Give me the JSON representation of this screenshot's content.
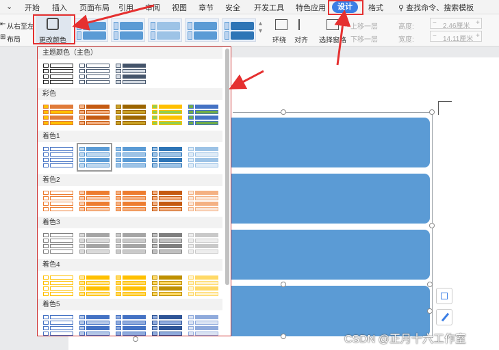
{
  "menubar": {
    "dropdown_icon": "chevron-down-icon",
    "items": [
      "开始",
      "插入",
      "页面布局",
      "引用",
      "审阅",
      "视图",
      "章节",
      "安全",
      "开发工具",
      "特色应用"
    ],
    "active": "设计",
    "format": "格式",
    "search": "查找命令、搜索模板"
  },
  "toolbar": {
    "rtl_label": "从右至左",
    "layout_label": "布局",
    "change_color_label": "更改颜色",
    "wrap_label": "环绕",
    "align_label": "对齐",
    "select_pane_label": "选择窗格",
    "move_up_label": "上移一层",
    "move_down_label": "下移一层",
    "height_label": "高度:",
    "height_value": "2.46厘米",
    "width_label": "宽度:",
    "width_value": "14.11厘米"
  },
  "dropdown": {
    "sections": [
      {
        "title": "主题颜色（主色）",
        "colors": [
          [
            "#222222",
            "#ffffff"
          ],
          [
            "#44546a",
            "#ffffff"
          ],
          [
            "#44546a",
            "#d6dce4"
          ]
        ]
      },
      {
        "title": "彩色",
        "colors": [
          [
            "#e07b39",
            "#ffc000"
          ],
          [
            "#c55a11",
            "#f4b183"
          ],
          [
            "#9c6500",
            "#c9a227"
          ],
          [
            "#ffc000",
            "#92d050"
          ],
          [
            "#4472c4",
            "#70ad47"
          ]
        ]
      },
      {
        "title": "着色1",
        "colors": [
          [
            "#4472c4",
            "#ffffff"
          ],
          [
            "#5b9bd5",
            "#bdd7ee"
          ],
          [
            "#5b9bd5",
            "#9dc3e6"
          ],
          [
            "#2e75b6",
            "#9dc3e6"
          ],
          [
            "#9dc3e6",
            "#deebf7"
          ]
        ]
      },
      {
        "title": "着色2",
        "colors": [
          [
            "#ed7d31",
            "#ffffff"
          ],
          [
            "#ed7d31",
            "#f8cbad"
          ],
          [
            "#ed7d31",
            "#f4b183"
          ],
          [
            "#c55a11",
            "#f4b183"
          ],
          [
            "#f4b183",
            "#fbe5d6"
          ]
        ]
      },
      {
        "title": "着色3",
        "colors": [
          [
            "#7f7f7f",
            "#ffffff"
          ],
          [
            "#a5a5a5",
            "#d9d9d9"
          ],
          [
            "#a5a5a5",
            "#c9c9c9"
          ],
          [
            "#7f7f7f",
            "#bfbfbf"
          ],
          [
            "#c9c9c9",
            "#ededed"
          ]
        ]
      },
      {
        "title": "着色4",
        "colors": [
          [
            "#ffc000",
            "#ffffff"
          ],
          [
            "#ffc000",
            "#ffe699"
          ],
          [
            "#ffc000",
            "#ffd966"
          ],
          [
            "#bf9000",
            "#ffd966"
          ],
          [
            "#ffd966",
            "#fff2cc"
          ]
        ]
      },
      {
        "title": "着色5",
        "colors": [
          [
            "#4472c4",
            "#ffffff"
          ],
          [
            "#4472c4",
            "#b4c7e7"
          ],
          [
            "#4472c4",
            "#8faadc"
          ],
          [
            "#2f5597",
            "#8faadc"
          ],
          [
            "#8faadc",
            "#dae3f3"
          ]
        ]
      }
    ]
  },
  "watermark": "CSDN @正月十六工作室",
  "colors": {
    "accent": "#3b7ee5",
    "bar": "#5b9bd5",
    "annotation": "#e53030"
  }
}
